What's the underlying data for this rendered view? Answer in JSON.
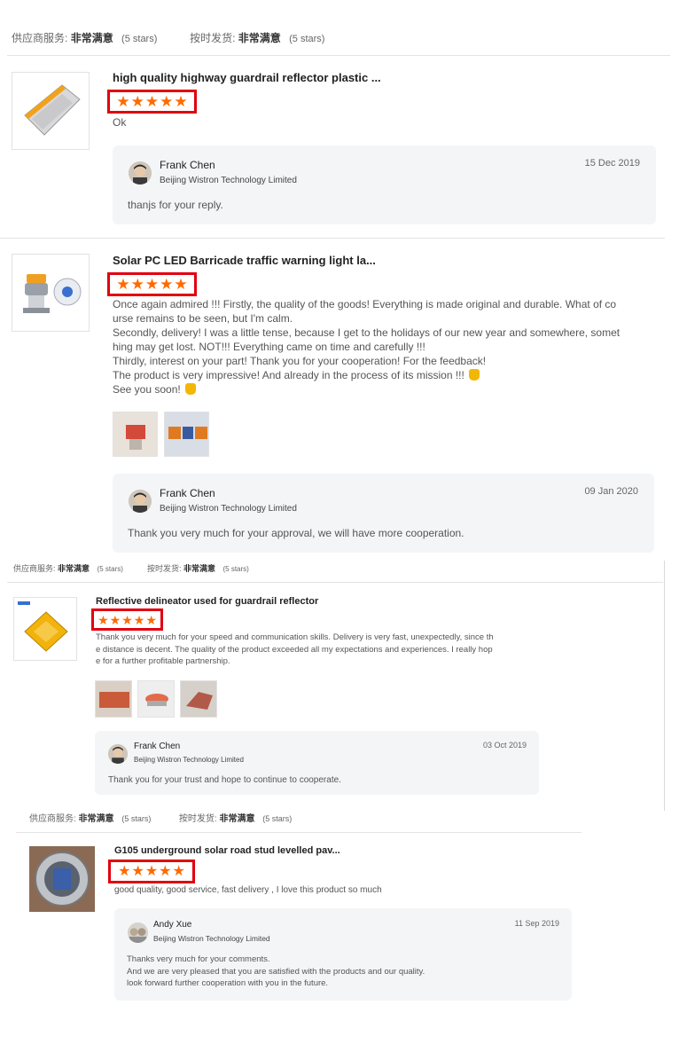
{
  "rating_bar": {
    "service_label": "供应商服务:",
    "service_value": "非常满意",
    "service_note": "(5 stars)",
    "shipping_label": "按时发货:",
    "shipping_value": "非常满意",
    "shipping_note": "(5 stars)"
  },
  "star_glyph": "★",
  "colors": {
    "star": "#ff6a00",
    "highlight_box": "#e1000f",
    "reply_bg": "#f4f5f7"
  },
  "reviews": [
    {
      "product_title": "high quality highway guardrail reflector plastic ...",
      "stars": 5,
      "text": "Ok",
      "reply": {
        "name": "Frank Chen",
        "company": "Beijing Wistron Technology Limited",
        "date": "15 Dec 2019",
        "message": "thanjs  for your  reply."
      }
    },
    {
      "product_title": "Solar PC LED Barricade traffic warning light la...",
      "stars": 5,
      "text_lines": [
        "Once again admired !!! Firstly, the quality of the goods! Everything is made original and durable. What of co",
        "urse remains to be seen, but I'm calm.",
        "Secondly, delivery! I was a little tense, because I get to the holidays of our new year and somewhere, somet",
        "hing may get lost. NOT!!! Everything came on time and carefully !!!",
        "Thirdly, interest on your part! Thank you for your cooperation! For the feedback!",
        "The product is very impressive! And already in the process of its mission !!!",
        "See you soon!"
      ],
      "reply": {
        "name": "Frank Chen",
        "company": "Beijing Wistron Technology Limited",
        "date": "09 Jan 2020",
        "message": "Thank you very much for your approval, we will have more cooperation."
      }
    },
    {
      "product_title": "Reflective delineator used for guardrail reflector",
      "stars": 5,
      "text": "Thank you very much for your speed and communication skills. Delivery is very fast, unexpectedly, since th\ne distance is decent. The quality of the product exceeded all my expectations and experiences. I really hop\ne for a further profitable partnership.",
      "reply": {
        "name": "Frank Chen",
        "company": "Beijing Wistron Technology Limited",
        "date": "03 Oct 2019",
        "message": "Thank you for your trust and hope to continue to cooperate."
      }
    },
    {
      "product_title": "G105 underground solar road stud levelled pav...",
      "stars": 5,
      "text": "good quality, good service, fast delivery , I love this product so much",
      "reply": {
        "name": "Andy Xue",
        "company": "Beijing Wistron Technology Limited",
        "date": "11 Sep 2019",
        "message": "Thanks very much for your comments.\nAnd we are very pleased that you are satisfied with the products and our quality.\nlook forward further cooperation with you in the future."
      }
    }
  ]
}
